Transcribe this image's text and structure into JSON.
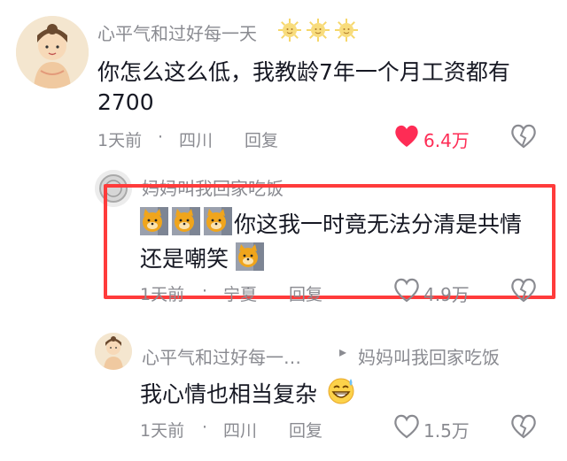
{
  "comment1": {
    "username": "心平气和过好每一天",
    "text_line1": "你怎么这么低，我教龄7年一个月工资都有",
    "text_line2": "2700",
    "time": "1天前",
    "separator": "·",
    "location": "四川",
    "reply_label": "回复",
    "like_count": "6.4万",
    "like_color": "#fe2c55",
    "icons": [
      "sun-emoji",
      "sun-emoji",
      "sun-emoji",
      "heart-icon",
      "broken-heart-icon"
    ]
  },
  "comment2": {
    "username": "妈妈叫我回家吃饭",
    "text_line1": "你这我一时竟无法分清是共情",
    "text_line2": "还是嘲笑",
    "time": "1天前",
    "separator": "·",
    "location": "宁夏",
    "reply_label": "回复",
    "like_count": "4.9万",
    "highlight_color": "#ff3b3b",
    "icons": [
      "dog-emoji",
      "dog-emoji",
      "dog-emoji",
      "dog-emoji",
      "heart-outline-icon",
      "broken-heart-icon"
    ]
  },
  "comment3": {
    "username": "心平气和过好每一…",
    "reply_arrow": "▸",
    "reply_to": "妈妈叫我回家吃饭",
    "text_line1": "我心情也相当复杂",
    "time": "1天前",
    "separator": "·",
    "location": "四川",
    "reply_label": "回复",
    "like_count": "1.5万",
    "icons": [
      "grin-sweat-emoji",
      "heart-outline-icon",
      "broken-heart-icon"
    ]
  }
}
